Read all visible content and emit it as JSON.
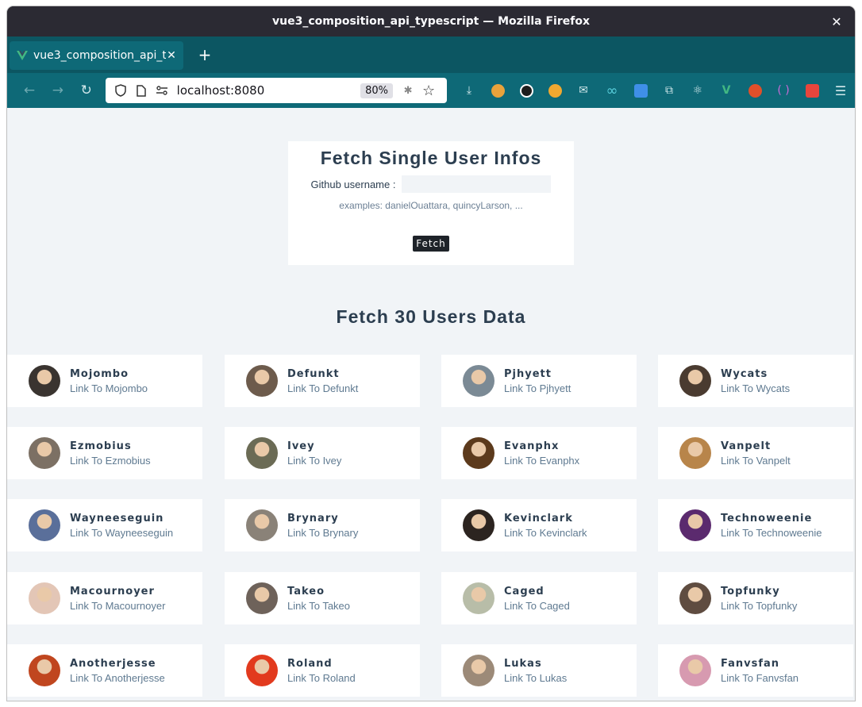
{
  "window": {
    "title": "vue3_composition_api_typescript — Mozilla Firefox",
    "close_glyph": "✕"
  },
  "tab": {
    "title": "vue3_composition_api_ty",
    "close_glyph": "✕",
    "new_tab_glyph": "+"
  },
  "nav": {
    "url": "localhost:8080",
    "zoom": "80%"
  },
  "single": {
    "title": "Fetch Single User Infos",
    "label": "Github username :",
    "input_value": "",
    "examples": "examples: danielOuattara, quincyLarson, ...",
    "button": "Fetch"
  },
  "multi": {
    "title": "Fetch 30 Users Data",
    "users": [
      {
        "name": "Mojombo",
        "link": "Link To Mojombo",
        "color": "#3a3430"
      },
      {
        "name": "Defunkt",
        "link": "Link To Defunkt",
        "color": "#6d5b4c"
      },
      {
        "name": "Pjhyett",
        "link": "Link To Pjhyett",
        "color": "#7b8a95"
      },
      {
        "name": "Wycats",
        "link": "Link To Wycats",
        "color": "#4a3b30"
      },
      {
        "name": "Ezmobius",
        "link": "Link To Ezmobius",
        "color": "#7c7064"
      },
      {
        "name": "Ivey",
        "link": "Link To Ivey",
        "color": "#6b6b55"
      },
      {
        "name": "Evanphx",
        "link": "Link To Evanphx",
        "color": "#5c3a1c"
      },
      {
        "name": "Vanpelt",
        "link": "Link To Vanpelt",
        "color": "#b8854a"
      },
      {
        "name": "Wayneeseguin",
        "link": "Link To Wayneeseguin",
        "color": "#5a6f9a"
      },
      {
        "name": "Brynary",
        "link": "Link To Brynary",
        "color": "#8a8278"
      },
      {
        "name": "Kevinclark",
        "link": "Link To Kevinclark",
        "color": "#2c2420"
      },
      {
        "name": "Technoweenie",
        "link": "Link To Technoweenie",
        "color": "#5b2a6e"
      },
      {
        "name": "Macournoyer",
        "link": "Link To Macournoyer",
        "color": "#e3c6b6"
      },
      {
        "name": "Takeo",
        "link": "Link To Takeo",
        "color": "#6e625a"
      },
      {
        "name": "Caged",
        "link": "Link To Caged",
        "color": "#b8bda8"
      },
      {
        "name": "Topfunky",
        "link": "Link To Topfunky",
        "color": "#5f4c40"
      },
      {
        "name": "Anotherjesse",
        "link": "Link To Anotherjesse",
        "color": "#c0461f"
      },
      {
        "name": "Roland",
        "link": "Link To Roland",
        "color": "#e23a1e"
      },
      {
        "name": "Lukas",
        "link": "Link To Lukas",
        "color": "#9c8a78"
      },
      {
        "name": "Fanvsfan",
        "link": "Link To Fanvsfan",
        "color": "#d79ab0"
      }
    ]
  },
  "ext_colors": [
    "#e9a23b",
    "#ffffff",
    "#f0a830",
    "#bfe3ea",
    "#5ad0dd",
    "#3f8fe8",
    "#d2e8eb",
    "#9fd9e3",
    "#42b883",
    "#e04f2a",
    "#c86bd8",
    "#e8453c"
  ]
}
